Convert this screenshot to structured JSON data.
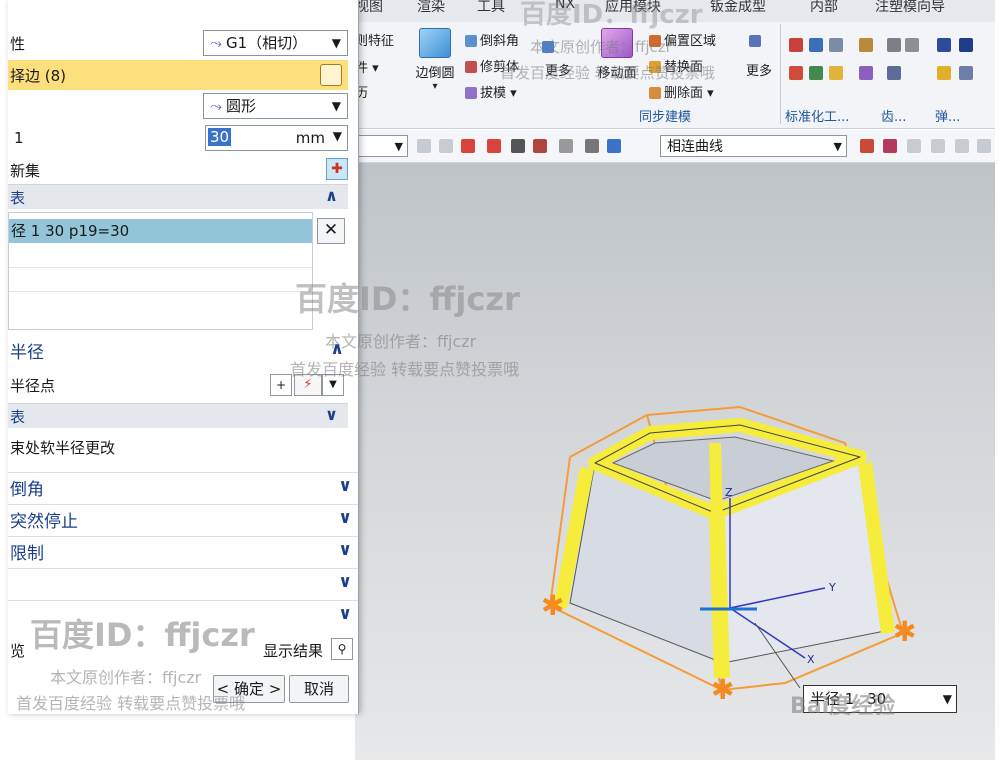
{
  "ribbon": {
    "tabs": [
      "视图",
      "渲染",
      "工具",
      "NX",
      "应用模块",
      "钣金成型",
      "内部",
      "注塑模向导"
    ],
    "feature_label": "则特征",
    "small_tool_1": "件",
    "small_tool_2": "历",
    "edge_blend": "边倒圆",
    "chamfer": "倒斜角",
    "trim_body": "修剪体",
    "draft": "拔模",
    "more1": "更多",
    "move_face": "移动面",
    "offset_region": "偏置区域",
    "replace_face": "替换面",
    "delete_face": "删除面",
    "more2": "更多",
    "group_sync": "同步建模",
    "group_std": "标准化工...",
    "group_gear": "齿...",
    "group_spring": "弹..."
  },
  "toolbar": {
    "curve_rule": "相连曲线"
  },
  "dialog": {
    "continuity_label": "性",
    "continuity_value": "G1（相切）",
    "select_edge": "择边 (8)",
    "shape_value": "圆形",
    "radius_label": "1",
    "radius_value": "30",
    "radius_unit": "mm",
    "new_set": "新集",
    "list_header": "表",
    "list_row": "径 1  30  p19=30",
    "variable_radius": "半径",
    "radius_point": "半径点",
    "list_header2": "表",
    "corner_setback": "束处软半径更改",
    "sec_corner": "倒角",
    "sec_stop": "突然停止",
    "sec_limit": "限制",
    "sec_4": "",
    "sec_5": "",
    "preview_label": "览",
    "show_result": "显示结果",
    "ok": "< 确定 >",
    "cancel": "取消"
  },
  "viewport": {
    "radius_label": "半径 1",
    "radius_value": "30",
    "axis_x": "X",
    "axis_y": "Y",
    "axis_z": "Z"
  },
  "watermark": {
    "id_text": "百度ID：ffjczr",
    "line1": "本文原创作者：ffjczr",
    "line2": "首发百度经验  转载要点赞投票哦",
    "logo": "Bai度经验"
  },
  "colors": {
    "highlight_row": "#fde07d",
    "list_select": "#92c5d7",
    "accent_blue": "#1b3f8a",
    "model_yellow": "#f5ec3c",
    "model_orange": "#f59b3a"
  }
}
